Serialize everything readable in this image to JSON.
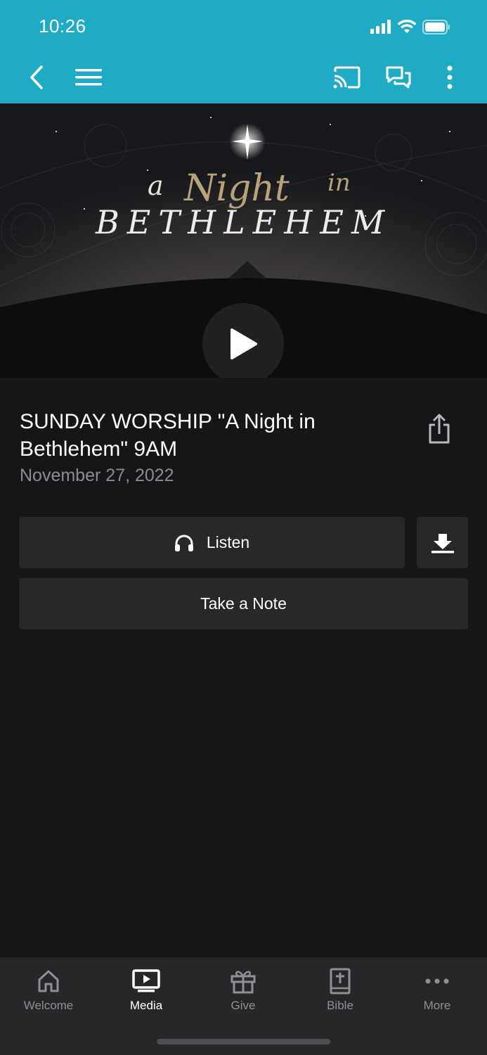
{
  "status_bar": {
    "time": "10:26"
  },
  "episode": {
    "title": "SUNDAY WORSHIP \"A Night in Bethlehem\" 9AM",
    "date": "November 27, 2022",
    "artwork_text": {
      "line1_a": "a",
      "line1_script": "Night",
      "line1_in": "in",
      "line2": "BETHLEHEM"
    }
  },
  "actions": {
    "listen_label": "Listen",
    "note_label": "Take a Note"
  },
  "tabs": [
    {
      "label": "Welcome",
      "icon": "home-icon",
      "active": false
    },
    {
      "label": "Media",
      "icon": "tv-play-icon",
      "active": true
    },
    {
      "label": "Give",
      "icon": "gift-icon",
      "active": false
    },
    {
      "label": "Bible",
      "icon": "bible-icon",
      "active": false
    },
    {
      "label": "More",
      "icon": "more-dots-icon",
      "active": false
    }
  ],
  "colors": {
    "header": "#1eabc3",
    "background": "#151618",
    "button": "#27282a",
    "tabbar": "#262729"
  }
}
